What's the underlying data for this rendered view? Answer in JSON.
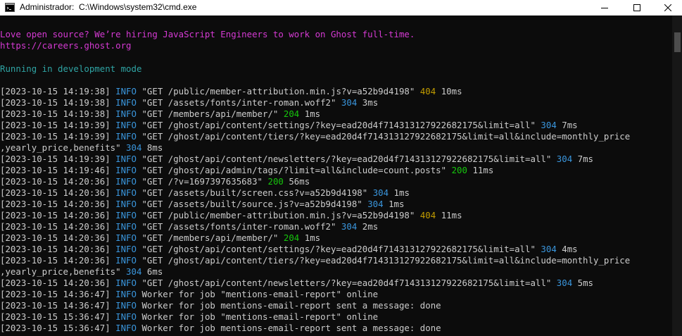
{
  "window": {
    "title": "Administrador:  C:\\Windows\\system32\\cmd.exe"
  },
  "terminal": {
    "banner": "Love open source? We’re hiring JavaScript Engineers to work on Ghost full-time.",
    "banner_url": "https://careers.ghost.org",
    "mode": "Running in development mode",
    "lines": [
      {
        "ts": "[2023-10-15 14:19:38]",
        "lvl": "INFO",
        "req": "\"GET /public/member-attribution.min.js?v=a52b9d4198\"",
        "code": "404",
        "time": "10ms"
      },
      {
        "ts": "[2023-10-15 14:19:38]",
        "lvl": "INFO",
        "req": "\"GET /assets/fonts/inter-roman.woff2\"",
        "code": "304",
        "time": "3ms"
      },
      {
        "ts": "[2023-10-15 14:19:38]",
        "lvl": "INFO",
        "req": "\"GET /members/api/member/\"",
        "code": "204",
        "time": "1ms"
      },
      {
        "ts": "[2023-10-15 14:19:39]",
        "lvl": "INFO",
        "req": "\"GET /ghost/api/content/settings/?key=ead20d4f714313127922682175&limit=all\"",
        "code": "304",
        "time": "7ms"
      },
      {
        "ts": "[2023-10-15 14:19:39]",
        "lvl": "INFO",
        "req": "\"GET /ghost/api/content/tiers/?key=ead20d4f714313127922682175&limit=all&include=monthly_price",
        "code": "",
        "time": ""
      },
      {
        "ts": "",
        "lvl": "",
        "req": ",yearly_price,benefits\"",
        "code": "304",
        "time": "8ms"
      },
      {
        "ts": "[2023-10-15 14:19:39]",
        "lvl": "INFO",
        "req": "\"GET /ghost/api/content/newsletters/?key=ead20d4f714313127922682175&limit=all\"",
        "code": "304",
        "time": "7ms"
      },
      {
        "ts": "[2023-10-15 14:19:46]",
        "lvl": "INFO",
        "req": "\"GET /ghost/api/admin/tags/?limit=all&include=count.posts\"",
        "code": "200",
        "time": "11ms"
      },
      {
        "ts": "[2023-10-15 14:20:36]",
        "lvl": "INFO",
        "req": "\"GET /?v=1697397635683\"",
        "code": "200",
        "time": "56ms"
      },
      {
        "ts": "[2023-10-15 14:20:36]",
        "lvl": "INFO",
        "req": "\"GET /assets/built/screen.css?v=a52b9d4198\"",
        "code": "304",
        "time": "1ms"
      },
      {
        "ts": "[2023-10-15 14:20:36]",
        "lvl": "INFO",
        "req": "\"GET /assets/built/source.js?v=a52b9d4198\"",
        "code": "304",
        "time": "1ms"
      },
      {
        "ts": "[2023-10-15 14:20:36]",
        "lvl": "INFO",
        "req": "\"GET /public/member-attribution.min.js?v=a52b9d4198\"",
        "code": "404",
        "time": "11ms"
      },
      {
        "ts": "[2023-10-15 14:20:36]",
        "lvl": "INFO",
        "req": "\"GET /assets/fonts/inter-roman.woff2\"",
        "code": "304",
        "time": "2ms"
      },
      {
        "ts": "[2023-10-15 14:20:36]",
        "lvl": "INFO",
        "req": "\"GET /members/api/member/\"",
        "code": "204",
        "time": "1ms"
      },
      {
        "ts": "[2023-10-15 14:20:36]",
        "lvl": "INFO",
        "req": "\"GET /ghost/api/content/settings/?key=ead20d4f714313127922682175&limit=all\"",
        "code": "304",
        "time": "4ms"
      },
      {
        "ts": "[2023-10-15 14:20:36]",
        "lvl": "INFO",
        "req": "\"GET /ghost/api/content/tiers/?key=ead20d4f714313127922682175&limit=all&include=monthly_price",
        "code": "",
        "time": ""
      },
      {
        "ts": "",
        "lvl": "",
        "req": ",yearly_price,benefits\"",
        "code": "304",
        "time": "6ms"
      },
      {
        "ts": "[2023-10-15 14:20:36]",
        "lvl": "INFO",
        "req": "\"GET /ghost/api/content/newsletters/?key=ead20d4f714313127922682175&limit=all\"",
        "code": "304",
        "time": "5ms"
      },
      {
        "ts": "[2023-10-15 14:36:47]",
        "lvl": "INFO",
        "req": "Worker for job \"mentions-email-report\" online",
        "code": "",
        "time": ""
      },
      {
        "ts": "[2023-10-15 14:36:47]",
        "lvl": "INFO",
        "req": "Worker for job mentions-email-report sent a message: done",
        "code": "",
        "time": ""
      },
      {
        "ts": "[2023-10-15 15:36:47]",
        "lvl": "INFO",
        "req": "Worker for job \"mentions-email-report\" online",
        "code": "",
        "time": ""
      },
      {
        "ts": "[2023-10-15 15:36:47]",
        "lvl": "INFO",
        "req": "Worker for job mentions-email-report sent a message: done",
        "code": "",
        "time": ""
      }
    ]
  },
  "colors": {
    "background": "#0c0c0c",
    "text": "#cccccc",
    "banner": "#d53ad3",
    "mode": "#2fa4a4",
    "info": "#3a96dd",
    "status_304": "#3a96dd",
    "status_404": "#c19c00",
    "status_2xx": "#16c60c"
  },
  "icons": {
    "app": "cmd-icon",
    "minimize": "minimize-icon",
    "maximize": "maximize-icon",
    "close": "close-icon"
  }
}
